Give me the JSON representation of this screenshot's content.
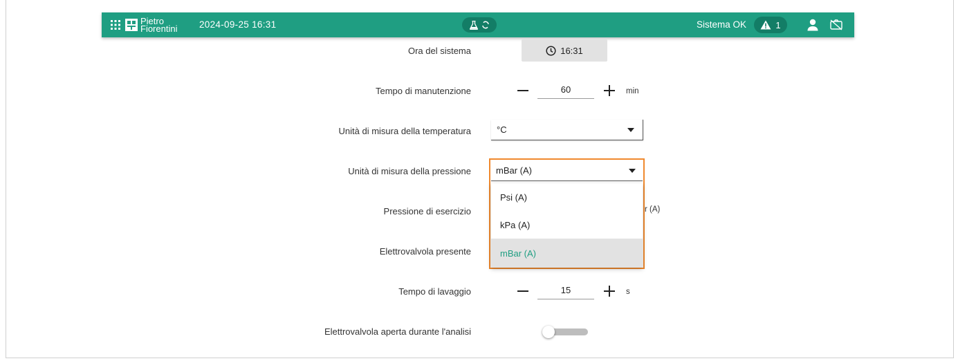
{
  "header": {
    "brand_line1": "Pietro",
    "brand_line2": "Fiorentini",
    "datetime": "2024-09-25 16:31",
    "status": "Sistema OK",
    "alarm_count": "1",
    "colors": {
      "bar": "#1f9e82",
      "pill": "#137d66",
      "highlight": "#f0892d"
    },
    "icons": [
      "apps-grid-icon",
      "flask-icon",
      "refresh-icon",
      "warning-icon",
      "user-icon",
      "camera-off-icon"
    ]
  },
  "settings": {
    "system_time": {
      "label": "Ora del sistema",
      "value": "16:31",
      "icon": "clock-icon"
    },
    "maintenance_time": {
      "label": "Tempo di manutenzione",
      "value": "60",
      "unit": "min"
    },
    "temperature_unit": {
      "label": "Unità di misura della temperatura",
      "value": "°C"
    },
    "pressure_unit": {
      "label": "Unità di misura della pressione",
      "value": "mBar (A)",
      "options": [
        "Psi (A)",
        "kPa (A)",
        "mBar (A)"
      ],
      "selected_index": 2
    },
    "operating_pressure": {
      "label": "Pressione di esercizio",
      "unit_partial": "r (A)"
    },
    "solenoid_present": {
      "label": "Elettrovalvola presente"
    },
    "wash_time": {
      "label": "Tempo di lavaggio",
      "value": "15",
      "unit": "s"
    },
    "solenoid_open": {
      "label": "Elettrovalvola aperta durante l'analisi",
      "enabled": false
    }
  }
}
